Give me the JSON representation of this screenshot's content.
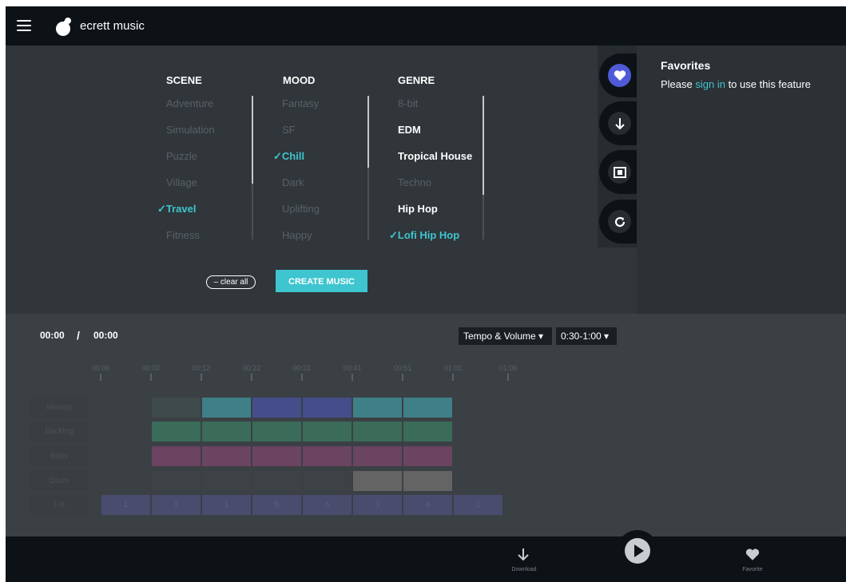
{
  "header": {
    "brand": "ecrett music"
  },
  "scene": {
    "title": "SCENE",
    "options": [
      {
        "label": "Adventure"
      },
      {
        "label": "Simulation"
      },
      {
        "label": "Puzzle"
      },
      {
        "label": "Village"
      },
      {
        "label": "✓Travel"
      },
      {
        "label": "Fitness"
      }
    ]
  },
  "mood": {
    "title": "MOOD",
    "options": [
      {
        "label": "Fantasy"
      },
      {
        "label": "SF"
      },
      {
        "label": "✓Chill"
      },
      {
        "label": "Dark"
      },
      {
        "label": "Uplifting"
      },
      {
        "label": "Happy"
      }
    ]
  },
  "genre": {
    "title": "GENRE",
    "options": [
      {
        "label": "8-bit"
      },
      {
        "label": "EDM"
      },
      {
        "label": "Tropical House"
      },
      {
        "label": "Techno"
      },
      {
        "label": "Hip Hop"
      },
      {
        "label": "✓Lofi Hip Hop"
      }
    ]
  },
  "actions": {
    "clear": "– clear all",
    "create": "CREATE MUSIC"
  },
  "favorites": {
    "title": "Favorites",
    "msg_pre": "Please ",
    "msg_link": "sign in",
    "msg_post": " to use this feature"
  },
  "player": {
    "current": "00:00",
    "separator": "/",
    "total": "00:00",
    "tempo_label": "Tempo & Volume ▾",
    "range_label": "0:30-1:00 ▾"
  },
  "ticks": [
    "00:00",
    "00:02",
    "00:12",
    "00:22",
    "00:31",
    "00:41",
    "00:51",
    "01:01",
    "01:06"
  ],
  "tracks": [
    "Melody",
    "Backing",
    "Bass",
    "Drum",
    "1-8"
  ],
  "bars": [
    "1",
    "1",
    "1",
    "5",
    "6",
    "3",
    "4",
    "1"
  ],
  "bottom": {
    "download": "Download",
    "favorite": "Favorite"
  },
  "colors": {
    "accent": "#3ec5cf",
    "heart_button": "#4f5bd5",
    "dark_bar": "#0d1217"
  }
}
